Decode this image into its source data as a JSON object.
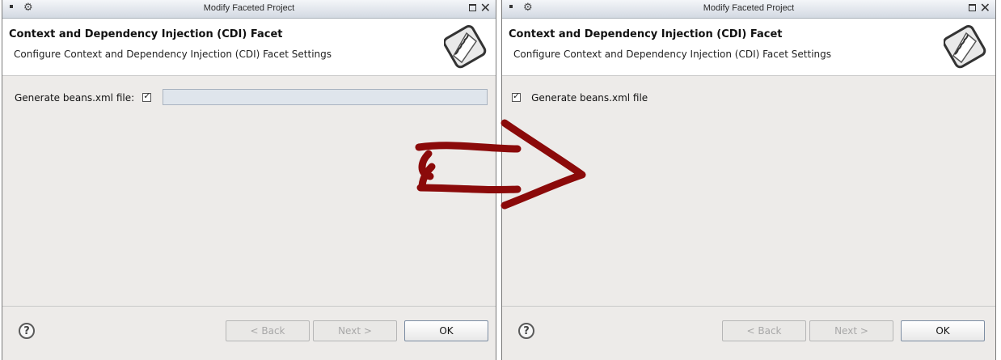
{
  "left_dialog": {
    "window_title": "Modify Faceted Project",
    "heading": "Context and Dependency Injection (CDI) Facet",
    "subheading": "Configure Context and Dependency Injection (CDI) Facet Settings",
    "option_label": "Generate beans.xml file:",
    "option_checked": true,
    "field_value": "",
    "help_label": "?",
    "back_label": "< Back",
    "next_label": "Next >",
    "ok_label": "OK"
  },
  "right_dialog": {
    "window_title": "Modify Faceted Project",
    "heading": "Context and Dependency Injection (CDI) Facet",
    "subheading": "Configure Context and Dependency Injection (CDI) Facet Settings",
    "option_label": "Generate beans.xml file",
    "option_checked": true,
    "help_label": "?",
    "back_label": "< Back",
    "next_label": "Next >",
    "ok_label": "OK"
  },
  "annotation": {
    "shape": "hand-drawn-arrow",
    "color": "#8b0a0a"
  },
  "icons": {
    "close": "close-icon",
    "maximize": "maximize-icon",
    "menu": "window-menu-icon",
    "app": "app-icon",
    "wizard": "wizard-banner-icon",
    "help": "help-icon"
  }
}
